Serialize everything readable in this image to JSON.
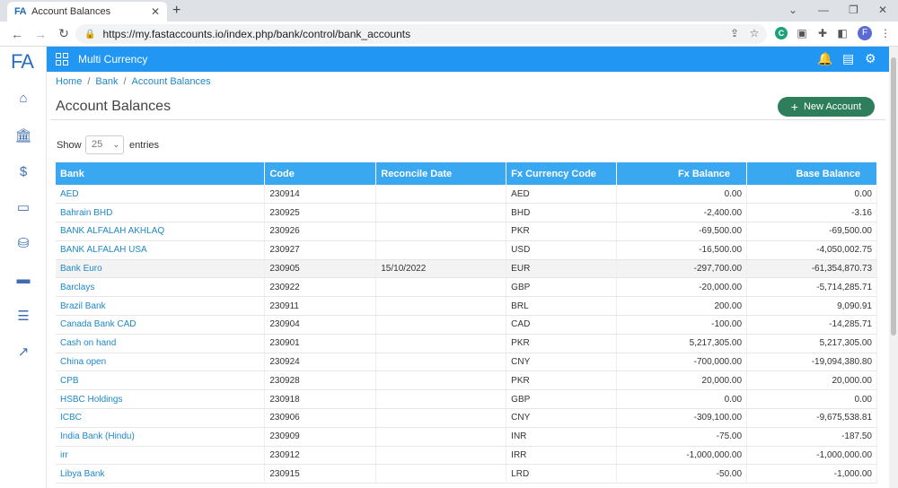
{
  "browser": {
    "tab_icon": "FA",
    "tab_title": "Account Balances",
    "url": "https://my.fastaccounts.io/index.php/bank/control/bank_accounts",
    "profile_initial": "F",
    "ext_badge": "C"
  },
  "app": {
    "logo": "FA",
    "section_title": "Multi Currency"
  },
  "breadcrumb": [
    "Home",
    "Bank",
    "Account Balances"
  ],
  "page_title": "Account Balances",
  "new_account_label": "New Account",
  "length_menu": {
    "show_label": "Show",
    "value": "25",
    "entries_label": "entries"
  },
  "table": {
    "headers": [
      "Bank",
      "Code",
      "Reconcile Date",
      "Fx Currency Code",
      "Fx Balance",
      "Base Balance"
    ],
    "rows": [
      {
        "bank": "AED",
        "code": "230914",
        "date": "",
        "ccy": "AED",
        "fx": "0.00",
        "base": "0.00"
      },
      {
        "bank": "Bahrain BHD",
        "code": "230925",
        "date": "",
        "ccy": "BHD",
        "fx": "-2,400.00",
        "base": "-3.16"
      },
      {
        "bank": "BANK ALFALAH AKHLAQ",
        "code": "230926",
        "date": "",
        "ccy": "PKR",
        "fx": "-69,500.00",
        "base": "-69,500.00"
      },
      {
        "bank": "BANK ALFALAH USA",
        "code": "230927",
        "date": "",
        "ccy": "USD",
        "fx": "-16,500.00",
        "base": "-4,050,002.75"
      },
      {
        "bank": "Bank Euro",
        "code": "230905",
        "date": "15/10/2022",
        "ccy": "EUR",
        "fx": "-297,700.00",
        "base": "-61,354,870.73"
      },
      {
        "bank": "Barclays",
        "code": "230922",
        "date": "",
        "ccy": "GBP",
        "fx": "-20,000.00",
        "base": "-5,714,285.71"
      },
      {
        "bank": "Brazil Bank",
        "code": "230911",
        "date": "",
        "ccy": "BRL",
        "fx": "200.00",
        "base": "9,090.91"
      },
      {
        "bank": "Canada Bank CAD",
        "code": "230904",
        "date": "",
        "ccy": "CAD",
        "fx": "-100.00",
        "base": "-14,285.71"
      },
      {
        "bank": "Cash on hand",
        "code": "230901",
        "date": "",
        "ccy": "PKR",
        "fx": "5,217,305.00",
        "base": "5,217,305.00"
      },
      {
        "bank": "China open",
        "code": "230924",
        "date": "",
        "ccy": "CNY",
        "fx": "-700,000.00",
        "base": "-19,094,380.80"
      },
      {
        "bank": "CPB",
        "code": "230928",
        "date": "",
        "ccy": "PKR",
        "fx": "20,000.00",
        "base": "20,000.00"
      },
      {
        "bank": "HSBC Holdings",
        "code": "230918",
        "date": "",
        "ccy": "GBP",
        "fx": "0.00",
        "base": "0.00"
      },
      {
        "bank": "ICBC",
        "code": "230906",
        "date": "",
        "ccy": "CNY",
        "fx": "-309,100.00",
        "base": "-9,675,538.81"
      },
      {
        "bank": "India Bank (Hindu)",
        "code": "230909",
        "date": "",
        "ccy": "INR",
        "fx": "-75.00",
        "base": "-187.50"
      },
      {
        "bank": "irr",
        "code": "230912",
        "date": "",
        "ccy": "IRR",
        "fx": "-1,000,000.00",
        "base": "-1,000,000.00"
      },
      {
        "bank": "Libya Bank",
        "code": "230915",
        "date": "",
        "ccy": "LRD",
        "fx": "-50.00",
        "base": "-1,000.00"
      }
    ]
  },
  "icons": {
    "sidebar": [
      "home-icon",
      "bank-icon",
      "dollar-icon",
      "cash-icon",
      "coins-icon",
      "card-icon",
      "list-icon",
      "chart-icon"
    ],
    "appbar": [
      "bell-icon",
      "report-icon",
      "gear-icon"
    ]
  },
  "colors": {
    "appbar": "#2196f3",
    "table_header": "#3aa8f0",
    "new_button": "#2e7d5b",
    "link": "#1e88c8"
  }
}
